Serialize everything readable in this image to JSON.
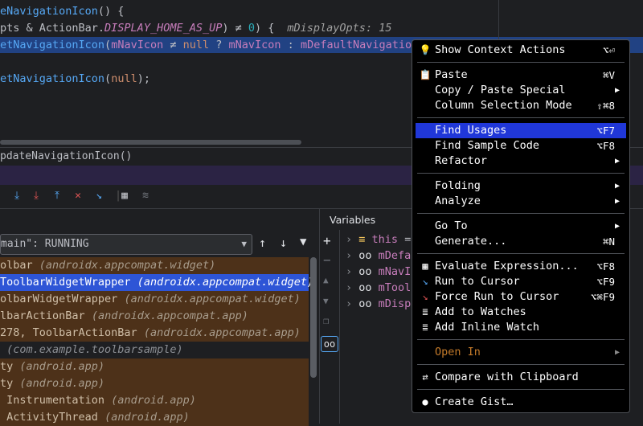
{
  "editor": {
    "lines": [
      {
        "a": "eNavigationIcon",
        "b": "() {"
      },
      {
        "a": "pts & ActionBar.",
        "const": "DISPLAY_HOME_AS_UP",
        "b": ") ≠ ",
        "num": "0",
        "c": ") {",
        "hint": "mDisplayOpts: 15"
      },
      {
        "fn": "etNavigationIcon",
        "p1": "(",
        "f1": "mNavIcon",
        "op": " ≠ ",
        "kw": "null",
        "q": " ? ",
        "f2": "mNavIcon",
        "colon": " : ",
        "f3": "mDefaultNavigation"
      },
      {
        "fn": "etNavigationIcon",
        "p1": "(",
        "kw": "null",
        "end": ");"
      }
    ],
    "breadcrumb": "pdateNavigationIcon()"
  },
  "frames": {
    "thread": "main\": RUNNING",
    "rows": [
      {
        "name": "olbar",
        "pkg": "(androidx.appcompat.widget)",
        "state": "normal"
      },
      {
        "name": "ToolbarWidgetWrapper",
        "pkg": "(androidx.appcompat.widget)",
        "state": "selected"
      },
      {
        "name": "olbarWidgetWrapper",
        "pkg": "(androidx.appcompat.widget)",
        "state": "normal"
      },
      {
        "name": "lbarActionBar",
        "pkg": "(androidx.appcompat.app)",
        "state": "normal"
      },
      {
        "name": "278, ToolbarActionBar",
        "pkg": "(androidx.appcompat.app)",
        "state": "normal"
      },
      {
        "name": "",
        "pkg": "(com.example.toolbarsample)",
        "state": "plain"
      },
      {
        "name": "ty",
        "pkg": "(android.app)",
        "state": "normal"
      },
      {
        "name": "ty",
        "pkg": "(android.app)",
        "state": "normal"
      },
      {
        "name": " Instrumentation",
        "pkg": "(android.app)",
        "state": "normal"
      },
      {
        "name": " ActivityThread",
        "pkg": "(android.app)",
        "state": "normal"
      }
    ]
  },
  "variables": {
    "title": "Variables",
    "rows": [
      {
        "prefix": "≡",
        "name": "this",
        "suffix": " ="
      },
      {
        "prefix": "oo",
        "name": "mDefau",
        "suffix": ""
      },
      {
        "prefix": "oo",
        "name": "mNavIc",
        "suffix": ""
      },
      {
        "prefix": "oo",
        "name": "mToolb",
        "suffix": ""
      },
      {
        "prefix": "oo",
        "name": "mDispl",
        "suffix": ""
      }
    ]
  },
  "menu": {
    "items": [
      {
        "id": "show-context-actions",
        "icon": "bulb-icon",
        "glyph": "💡",
        "label": "Show Context Actions",
        "shortcut": "⌥⏎"
      },
      {
        "id": "paste",
        "icon": "clipboard-icon",
        "glyph": "📋",
        "label": "Paste",
        "shortcut": "⌘V"
      },
      {
        "id": "copy-paste-special",
        "icon": "",
        "glyph": "",
        "label": "Copy / Paste Special",
        "shortcut": "",
        "submenu": true
      },
      {
        "id": "column-selection-mode",
        "icon": "",
        "glyph": "",
        "label": "Column Selection Mode",
        "shortcut": "⇧⌘8"
      },
      {
        "id": "find-usages",
        "icon": "",
        "glyph": "",
        "label": "Find Usages",
        "shortcut": "⌥F7",
        "highlight": true
      },
      {
        "id": "find-sample-code",
        "icon": "",
        "glyph": "",
        "label": "Find Sample Code",
        "shortcut": "⌥F8"
      },
      {
        "id": "refactor",
        "icon": "",
        "glyph": "",
        "label": "Refactor",
        "shortcut": "",
        "submenu": true
      },
      {
        "id": "folding",
        "icon": "",
        "glyph": "",
        "label": "Folding",
        "shortcut": "",
        "submenu": true
      },
      {
        "id": "analyze",
        "icon": "",
        "glyph": "",
        "label": "Analyze",
        "shortcut": "",
        "submenu": true
      },
      {
        "id": "go-to",
        "icon": "",
        "glyph": "",
        "label": "Go To",
        "shortcut": "",
        "submenu": true
      },
      {
        "id": "generate",
        "icon": "",
        "glyph": "",
        "label": "Generate...",
        "shortcut": "⌘N"
      },
      {
        "id": "evaluate-expression",
        "icon": "calculator-icon",
        "glyph": "▦",
        "label": "Evaluate Expression...",
        "shortcut": "⌥F8"
      },
      {
        "id": "run-to-cursor",
        "icon": "run-to-cursor-icon",
        "glyph": "↘",
        "label": "Run to Cursor",
        "shortcut": "⌥F9"
      },
      {
        "id": "force-run-to-cursor",
        "icon": "force-run-icon",
        "glyph": "↘",
        "label": "Force Run to Cursor",
        "shortcut": "⌥⌘F9"
      },
      {
        "id": "add-to-watches",
        "icon": "watches-icon",
        "glyph": "≣",
        "label": "Add to Watches",
        "shortcut": ""
      },
      {
        "id": "add-inline-watch",
        "icon": "inline-watch-icon",
        "glyph": "≣",
        "label": "Add Inline Watch",
        "shortcut": ""
      },
      {
        "id": "open-in",
        "icon": "",
        "glyph": "",
        "label": "Open In",
        "shortcut": "",
        "submenu": true,
        "dim": true
      },
      {
        "id": "compare-with-clipboard",
        "icon": "compare-icon",
        "glyph": "⇄",
        "label": "Compare with Clipboard",
        "shortcut": ""
      },
      {
        "id": "create-gist",
        "icon": "github-icon",
        "glyph": "●",
        "label": "Create Gist…",
        "shortcut": ""
      }
    ]
  }
}
